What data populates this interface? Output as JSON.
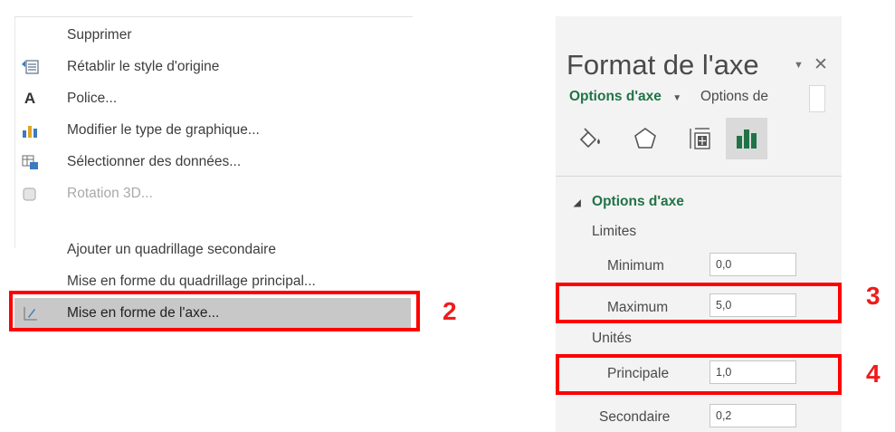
{
  "context_menu": {
    "items": [
      {
        "label": "Supprimer",
        "icon": "none",
        "disabled": false
      },
      {
        "label": "Rétablir le style d'origine",
        "icon": "reset-style-icon",
        "disabled": false
      },
      {
        "label": "Police...",
        "icon": "font-icon",
        "disabled": false
      },
      {
        "label": "Modifier le type de graphique...",
        "icon": "chart-type-icon",
        "disabled": false
      },
      {
        "label": "Sélectionner des données...",
        "icon": "select-data-icon",
        "disabled": false
      },
      {
        "label": "Rotation 3D...",
        "icon": "rotation-3d-icon",
        "disabled": true
      },
      {
        "label": "Ajouter un quadrillage secondaire",
        "icon": "none",
        "disabled": false
      },
      {
        "label": "Mise en forme du quadrillage principal...",
        "icon": "none",
        "disabled": false
      },
      {
        "label": "Mise en forme de l'axe...",
        "icon": "format-axis-icon",
        "disabled": false,
        "highlighted": true
      }
    ],
    "font_icon_glyph": "A"
  },
  "annotations": {
    "step_2": "2",
    "step_3": "3",
    "step_4": "4",
    "color": "#ff0000"
  },
  "format_pane": {
    "title": "Format de l'axe",
    "dropdown_glyph": "▼",
    "close_glyph": "✕",
    "tabs": {
      "selected": "Options d'axe",
      "other": "Options de",
      "dropdown_glyph": "▼"
    },
    "sub_icons": [
      "fill-line-icon",
      "effects-icon",
      "size-properties-icon",
      "axis-options-icon"
    ],
    "section_header": "Options d'axe",
    "section_collapse_glyph": "◢",
    "limits": {
      "label": "Limites",
      "minimum": {
        "label": "Minimum",
        "value": "0,0"
      },
      "maximum": {
        "label": "Maximum",
        "value": "5,0"
      }
    },
    "units": {
      "label": "Unités",
      "principale": {
        "label": "Principale",
        "value": "1,0"
      },
      "secondaire": {
        "label": "Secondaire",
        "value": "0,2"
      }
    },
    "accent_color": "#217346"
  }
}
